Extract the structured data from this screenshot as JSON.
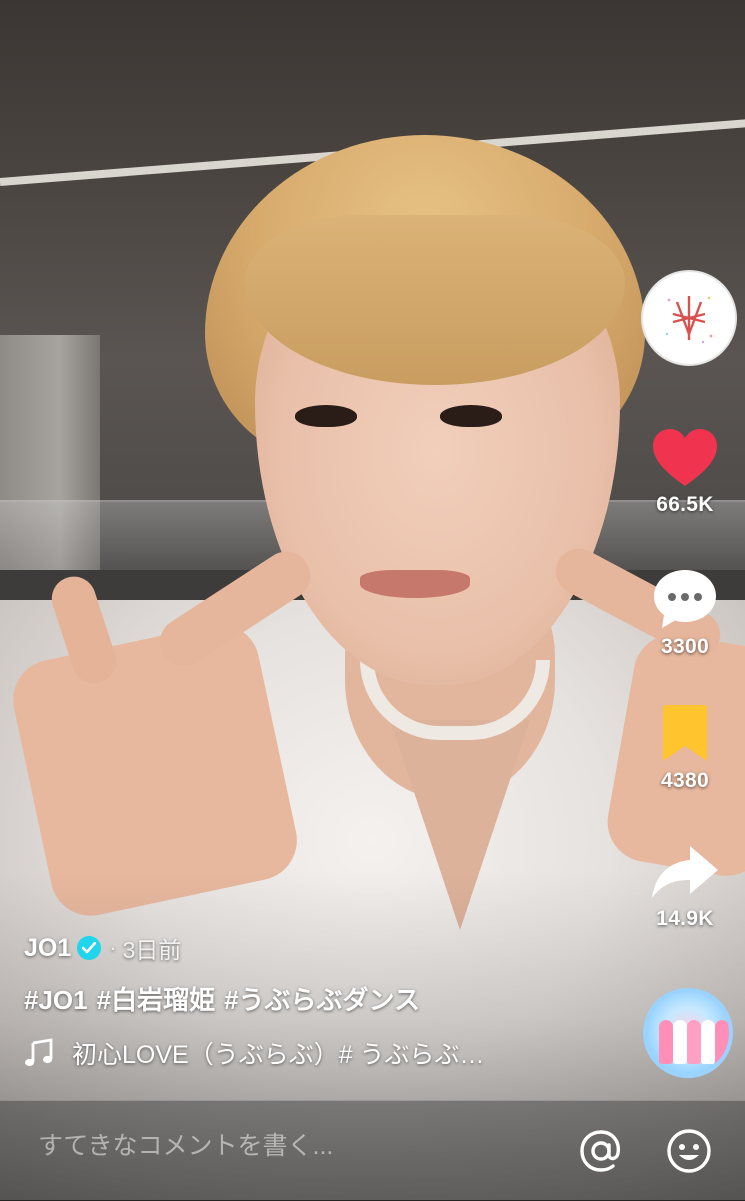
{
  "app": {
    "accent_like": "#f0344f",
    "accent_save": "#ffc42e",
    "verified_color": "#20d5ec"
  },
  "actions": {
    "like": {
      "icon": "heart-icon",
      "count": "66.5K"
    },
    "comment": {
      "icon": "comment-bubble-icon",
      "count": "3300"
    },
    "save": {
      "icon": "bookmark-icon",
      "count": "4380"
    },
    "share": {
      "icon": "share-arrow-icon",
      "count": "14.9K"
    }
  },
  "caption": {
    "author": "JO1",
    "separator": "·",
    "time_ago": "3日前",
    "hashtags": [
      "#JO1",
      "#白岩瑠姫",
      "#うぶらぶダンス"
    ],
    "music": "初心LOVE（うぶらぶ）# うぶらぶ…"
  },
  "comment_bar": {
    "placeholder": "すてきなコメントを書く...",
    "mention_icon": "at-icon",
    "emoji_icon": "emoji-icon"
  }
}
